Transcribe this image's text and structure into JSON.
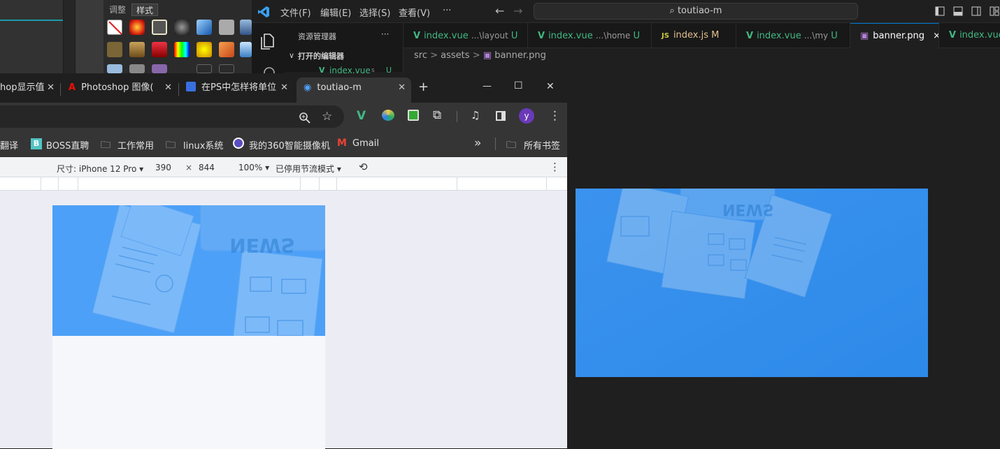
{
  "photoshop": {
    "tabs": [
      "调整",
      "样式"
    ]
  },
  "vscode": {
    "menu": [
      "文件(F)",
      "编辑(E)",
      "选择(S)",
      "查看(V)",
      "···"
    ],
    "search_text": "toutiao-m",
    "explorer_title": "资源管理器",
    "explorer_more": "···",
    "open_editors_label": "打开的编辑器",
    "open_editor_item": "index.vue",
    "open_editor_hint": "s",
    "open_editor_status": "U",
    "tabs": [
      {
        "name": "index.vue",
        "path": "...\\layout",
        "status": "U"
      },
      {
        "name": "index.vue",
        "path": "...\\home",
        "status": "U"
      },
      {
        "name": "index.js",
        "path": "",
        "status": "M"
      },
      {
        "name": "index.vue",
        "path": "...\\my",
        "status": "U"
      },
      {
        "name": "banner.png",
        "path": "",
        "status": "×"
      },
      {
        "name": "index.vue",
        "path": "",
        "status": ""
      }
    ],
    "breadcrumb": [
      "src",
      ">",
      "assets",
      ">",
      "banner.png"
    ]
  },
  "chrome": {
    "tabs": [
      {
        "title": "hop显示值"
      },
      {
        "title": "Photoshop 图像("
      },
      {
        "title": "在PS中怎样将单位"
      },
      {
        "title": "toutiao-m"
      }
    ],
    "new_tab": "+",
    "window_controls": [
      "—",
      "☐",
      "✕"
    ],
    "profile_initial": "y",
    "bookmarks": [
      "翻译",
      "BOSS直聘",
      "工作常用",
      "linux系统",
      "我的360智能摄像机",
      "Gmail",
      "所有书签"
    ],
    "bookmarks_overflow": "»",
    "devtools": {
      "device_label": "尺寸: iPhone 12 Pro",
      "width": "390",
      "times": "×",
      "height": "844",
      "zoom": "100%",
      "throttle": "已停用节流模式"
    }
  },
  "banner": {
    "word": "NEWS"
  },
  "colors": {
    "banner_blue": "#4d9ff5",
    "banner_blue_dark": "#2f8be6",
    "vue_green": "#41b883",
    "vs_accent": "#0078d4"
  }
}
